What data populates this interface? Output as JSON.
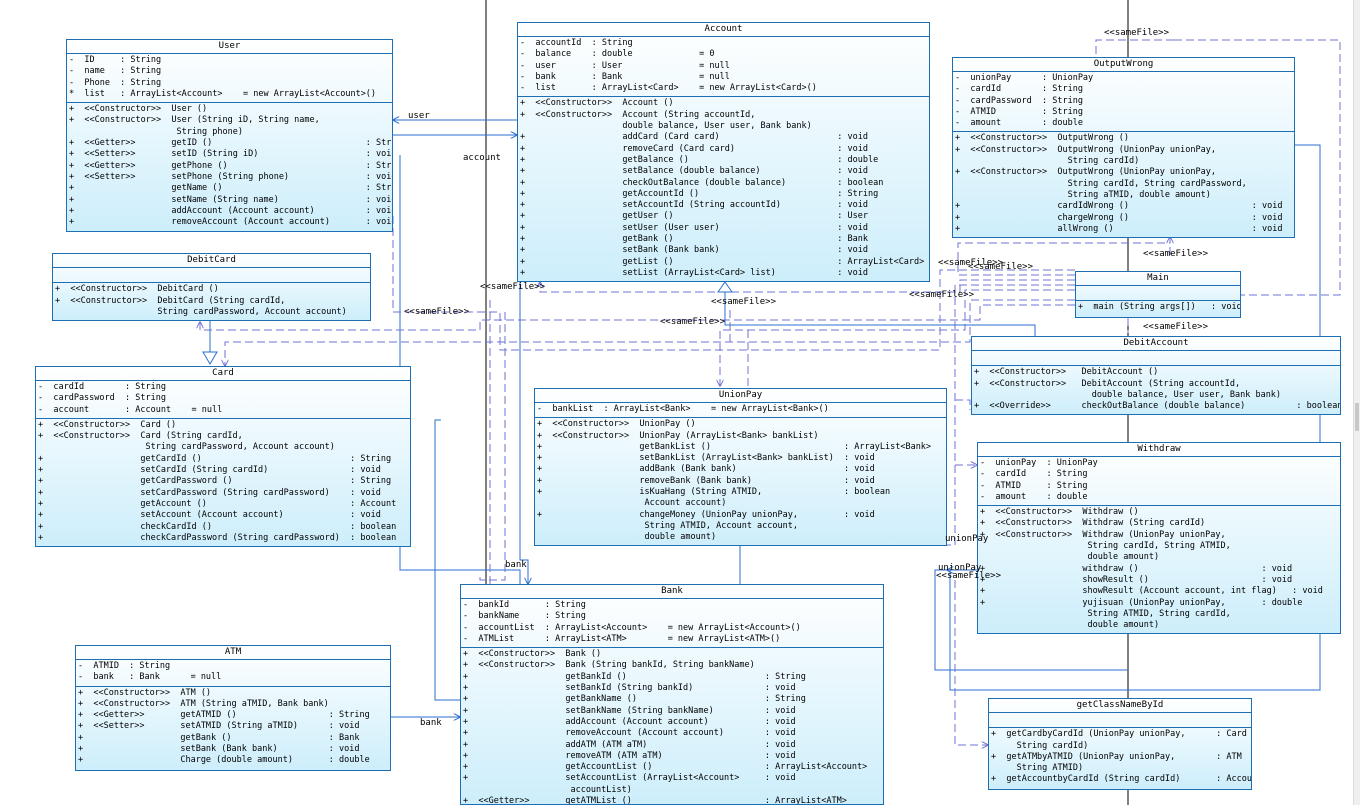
{
  "classes": [
    {
      "id": "user",
      "title": "User",
      "sections": [
        [
          "-  ID     : String",
          "-  name   : String",
          "-  Phone  : String",
          "*  list   : ArrayList<Account>    = new ArrayList<Account>()"
        ],
        [
          "+  <<Constructor>>  User ()",
          "+  <<Constructor>>  User (String iD, String name,",
          "                     String phone)",
          "+  <<Getter>>       getID ()                              : String",
          "+  <<Setter>>       setID (String iD)                     : void",
          "+  <<Getter>>       getPhone ()                           : String",
          "+  <<Setter>>       setPhone (String phone)               : void",
          "+                   getName ()                            : String",
          "+                   setName (String name)                 : void",
          "+                   addAccount (Account account)          : void",
          "+                   removeAccount (Account account)       : void"
        ]
      ]
    },
    {
      "id": "debitcard",
      "title": "DebitCard",
      "sections": [
        [
          " "
        ],
        [
          "+  <<Constructor>>  DebitCard ()",
          "+  <<Constructor>>  DebitCard (String cardId,",
          "                    String cardPassword, Account account)"
        ]
      ]
    },
    {
      "id": "card",
      "title": "Card",
      "sections": [
        [
          "-  cardId        : String",
          "-  cardPassword  : String",
          "-  account       : Account    = null"
        ],
        [
          "+  <<Constructor>>  Card ()",
          "+  <<Constructor>>  Card (String cardId,",
          "                     String cardPassword, Account account)",
          "+                   getCardId ()                             : String",
          "+                   setCardId (String cardId)                : void",
          "+                   getCardPassword ()                       : String",
          "+                   setCardPassword (String cardPassword)    : void",
          "+                   getAccount ()                            : Account",
          "+                   setAccount (Account account)             : void",
          "+                   checkCardId ()                           : boolean",
          "+                   checkCardPassword (String cardPassword)  : boolean"
        ]
      ]
    },
    {
      "id": "atm",
      "title": "ATM",
      "sections": [
        [
          "-  ATMID  : String",
          "-  bank   : Bank      = null"
        ],
        [
          "+  <<Constructor>>  ATM ()",
          "+  <<Constructor>>  ATM (String aTMID, Bank bank)",
          "+  <<Getter>>       getATMID ()                  : String",
          "+  <<Setter>>       setATMID (String aTMID)      : void",
          "+                   getBank ()                   : Bank",
          "+                   setBank (Bank bank)          : void",
          "+                   Charge (double amount)       : double"
        ]
      ]
    },
    {
      "id": "account",
      "title": "Account",
      "sections": [
        [
          "-  accountId  : String",
          "-  balance    : double             = 0",
          "-  user       : User               = null",
          "-  bank       : Bank               = null",
          "-  list       : ArrayList<Card>    = new ArrayList<Card>()"
        ],
        [
          "+  <<Constructor>>  Account ()",
          "+  <<Constructor>>  Account (String accountId,",
          "                    double balance, User user, Bank bank)",
          "+                   addCard (Card card)                       : void",
          "+                   removeCard (Card card)                    : void",
          "+                   getBalance ()                             : double",
          "+                   setBalance (double balance)               : void",
          "+                   checkOutBalance (double balance)          : boolean",
          "+                   getAccountId ()                           : String",
          "+                   setAccountId (String accountId)           : void",
          "+                   getUser ()                                : User",
          "+                   setUser (User user)                       : void",
          "+                   getBank ()                                : Bank",
          "+                   setBank (Bank bank)                       : void",
          "+                   getList ()                                : ArrayList<Card>",
          "+                   setList (ArrayList<Card> list)            : void"
        ]
      ]
    },
    {
      "id": "unionpay",
      "title": "UnionPay",
      "sections": [
        [
          "-  bankList  : ArrayList<Bank>    = new ArrayList<Bank>()"
        ],
        [
          "+  <<Constructor>>  UnionPay ()",
          "+  <<Constructor>>  UnionPay (ArrayList<Bank> bankList)",
          "+                   getBankList ()                          : ArrayList<Bank>",
          "+                   setBankList (ArrayList<Bank> bankList)  : void",
          "+                   addBank (Bank bank)                     : void",
          "+                   removeBank (Bank bank)                  : void",
          "+                   isKuaHang (String ATMID,                : boolean",
          "                     Account account)",
          "+                   changeMoney (UnionPay unionPay,         : void",
          "                     String ATMID, Account account,",
          "                     double amount)"
        ]
      ]
    },
    {
      "id": "bank",
      "title": "Bank",
      "sections": [
        [
          "-  bankId       : String",
          "-  bankName     : String",
          "-  accountList  : ArrayList<Account>    = new ArrayList<Account>()",
          "-  ATMList      : ArrayList<ATM>        = new ArrayList<ATM>()"
        ],
        [
          "+  <<Constructor>>  Bank ()",
          "+  <<Constructor>>  Bank (String bankId, String bankName)",
          "+                   getBankId ()                           : String",
          "+                   setBankId (String bankId)              : void",
          "+                   getBankName ()                         : String",
          "+                   setBankName (String bankName)          : void",
          "+                   addAccount (Account account)           : void",
          "+                   removeAccount (Account account)        : void",
          "+                   addATM (ATM aTM)                       : void",
          "+                   removeATM (ATM aTM)                    : void",
          "+                   getAccountList ()                      : ArrayList<Account>",
          "+                   setAccountList (ArrayList<Account>     : void",
          "                     accountList)",
          "+  <<Getter>>       getATMList ()                          : ArrayList<ATM>"
        ]
      ]
    },
    {
      "id": "outputwrong",
      "title": "OutputWrong",
      "sections": [
        [
          "-  unionPay      : UnionPay",
          "-  cardId        : String",
          "-  cardPassword  : String",
          "-  ATMID         : String",
          "-  amount        : double"
        ],
        [
          "+  <<Constructor>>  OutputWrong ()",
          "+  <<Constructor>>  OutputWrong (UnionPay unionPay,",
          "                      String cardId)",
          "+  <<Constructor>>  OutputWrong (UnionPay unionPay,",
          "                      String cardId, String cardPassword,",
          "                      String aTMID, double amount)",
          "+                   cardIdWrong ()                        : void",
          "+                   chargeWrong ()                        : void",
          "+                   allWrong ()                           : void"
        ]
      ]
    },
    {
      "id": "main",
      "title": "Main",
      "sections": [
        [
          " "
        ],
        [
          "+  main (String args[])   : void"
        ]
      ]
    },
    {
      "id": "debitaccount",
      "title": "DebitAccount",
      "sections": [
        [
          " "
        ],
        [
          "+  <<Constructor>>   DebitAccount ()",
          "+  <<Constructor>>   DebitAccount (String accountId,",
          "                       double balance, User user, Bank bank)",
          "+  <<Override>>      checkOutBalance (double balance)          : boolean"
        ]
      ]
    },
    {
      "id": "withdraw",
      "title": "Withdraw",
      "sections": [
        [
          "-  unionPay  : UnionPay",
          "-  cardId    : String",
          "-  ATMID     : String",
          "-  amount    : double"
        ],
        [
          "+  <<Constructor>>  Withdraw ()",
          "+  <<Constructor>>  Withdraw (String cardId)",
          "+  <<Constructor>>  Withdraw (UnionPay unionPay,",
          "                     String cardId, String ATMID,",
          "                     double amount)",
          "+                   withdraw ()                        : void",
          "+                   showResult ()                      : void",
          "+                   showResult (Account account, int flag)   : void",
          "+                   yujisuan (UnionPay unionPay,       : double",
          "                     String ATMID, String cardId,",
          "                     double amount)"
        ]
      ]
    },
    {
      "id": "getclassnamebyid",
      "title": "getClassNameById",
      "sections": [
        [
          " "
        ],
        [
          "+  getCardbyCardId (UnionPay unionPay,      : Card",
          "     String cardId)",
          "+  getATMbyATMID (UnionPay unionPay,        : ATM",
          "     String ATMID)",
          "+  getAccountbyCardId (String cardId)       : Account"
        ]
      ]
    }
  ],
  "relations": [
    {
      "id": "user-label",
      "text": "user"
    },
    {
      "id": "account-label",
      "text": "account"
    },
    {
      "id": "bank-label-1",
      "text": "bank"
    },
    {
      "id": "bank-label-2",
      "text": "bank"
    },
    {
      "id": "unionpay-label-1",
      "text": "unionPay"
    },
    {
      "id": "unionpay-label-2",
      "text": "unionPay"
    },
    {
      "id": "samefile-1",
      "text": "<<sameFile>>"
    },
    {
      "id": "samefile-2",
      "text": "<<sameFile>>"
    },
    {
      "id": "samefile-3",
      "text": "<<sameFile>>"
    },
    {
      "id": "samefile-4",
      "text": "<<sameFile>>"
    },
    {
      "id": "samefile-5",
      "text": "<<sameFile>>"
    },
    {
      "id": "samefile-6",
      "text": "<<sameFile>>"
    },
    {
      "id": "samefile-7",
      "text": "<<sameFile>>"
    },
    {
      "id": "samefile-8",
      "text": "<<sameFile>>"
    },
    {
      "id": "samefile-9",
      "text": "<<sameFile>>"
    },
    {
      "id": "samefile-10",
      "text": "<<sameFile>>"
    },
    {
      "id": "samefile-11",
      "text": "<<sameFile>>"
    }
  ],
  "colors": {
    "border": "#1e6eb3",
    "fill_top": "#ffffff",
    "fill_bottom": "#cdeefb",
    "line": "#2a6fd0",
    "dash": "#6f73d6"
  }
}
